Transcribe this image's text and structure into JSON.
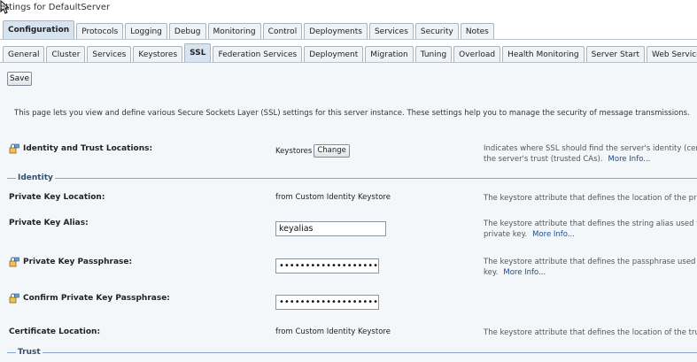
{
  "page": {
    "title": "ettings for DefaultServer"
  },
  "tabs_primary": [
    {
      "label": "Configuration",
      "active": true
    },
    {
      "label": "Protocols"
    },
    {
      "label": "Logging"
    },
    {
      "label": "Debug"
    },
    {
      "label": "Monitoring"
    },
    {
      "label": "Control"
    },
    {
      "label": "Deployments"
    },
    {
      "label": "Services"
    },
    {
      "label": "Security"
    },
    {
      "label": "Notes"
    }
  ],
  "tabs_secondary": [
    {
      "label": "General"
    },
    {
      "label": "Cluster"
    },
    {
      "label": "Services"
    },
    {
      "label": "Keystores"
    },
    {
      "label": "SSL",
      "active": true
    },
    {
      "label": "Federation Services"
    },
    {
      "label": "Deployment"
    },
    {
      "label": "Migration"
    },
    {
      "label": "Tuning"
    },
    {
      "label": "Overload"
    },
    {
      "label": "Health Monitoring"
    },
    {
      "label": "Server Start"
    },
    {
      "label": "Web Services"
    }
  ],
  "toolbar": {
    "save_label": "Save"
  },
  "intro": "This page lets you view and define various Secure Sockets Layer (SSL) settings for this server instance. These settings help you to manage the security of message transmissions.",
  "identity_trust": {
    "label": "Identity and Trust Locations:",
    "value": "Keystores",
    "change_label": "Change",
    "desc_line1": "Indicates where SSL should find the server's identity (certificate",
    "desc_line2": "the server's trust (trusted CAs).",
    "more": "More Info..."
  },
  "sections": {
    "identity": "Identity",
    "trust": "Trust"
  },
  "rows": {
    "private_key_location": {
      "label": "Private Key Location:",
      "value": "from Custom Identity Keystore",
      "desc": "The keystore attribute that defines the location of the private k"
    },
    "private_key_alias": {
      "label": "Private Key Alias:",
      "value": "keyalias",
      "desc_line1": "The keystore attribute that defines the string alias used to stor",
      "desc_line2": "private key.",
      "more": "More Info..."
    },
    "private_key_passphrase": {
      "label": "Private Key Passphrase:",
      "value": "•••••••••••••••••••",
      "desc_line1": "The keystore attribute that defines the passphrase used to ret",
      "desc_line2": "key.",
      "more": "More Info..."
    },
    "confirm_passphrase": {
      "label": "Confirm Private Key Passphrase:",
      "value": "•••••••••••••••••••"
    },
    "certificate_location": {
      "label": "Certificate Location:",
      "value": "from Custom Identity Keystore",
      "desc": "The keystore attribute that defines the location of the trusted"
    }
  },
  "colors": {
    "accent": "#35506f",
    "link": "#1a4c8a",
    "band": "#f4f7fa"
  }
}
